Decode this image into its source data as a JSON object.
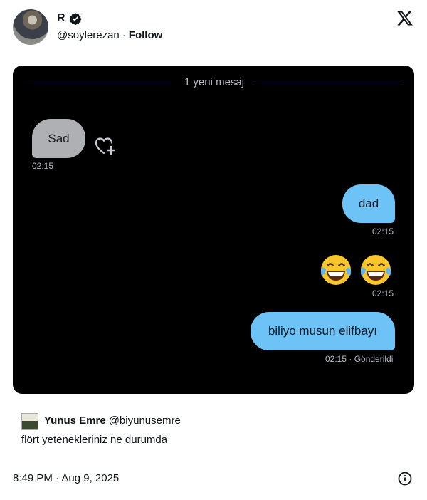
{
  "header": {
    "name": "R",
    "handle": "@soylerezan",
    "separator": "·",
    "follow_label": "Follow"
  },
  "media": {
    "divider_label": "1 yeni mesaj",
    "messages": [
      {
        "side": "incoming",
        "text": "Sad",
        "time": "02:15"
      },
      {
        "side": "outgoing",
        "text": "dad",
        "time": "02:15"
      },
      {
        "side": "outgoing",
        "text": "😂😂",
        "time": "02:15"
      },
      {
        "side": "outgoing",
        "text": "biliyo musun elifbayı",
        "time": "02:15 · Gönderildi"
      }
    ]
  },
  "quote": {
    "name": "Yunus Emre",
    "handle": "@biyunusemre",
    "text": "flört yetenekleriniz ne durumda"
  },
  "footer": {
    "timestamp": "8:49 PM · Aug 9, 2025"
  },
  "colors": {
    "incoming_bubble": "#aeb0b4",
    "outgoing_bubble": "#6dc3f5",
    "media_background": "#000000",
    "verified_badge": "#0f1419"
  },
  "icons": [
    "verified-badge-icon",
    "x-logo-icon",
    "heart-plus-icon",
    "laughing-emoji-icon",
    "info-icon"
  ]
}
